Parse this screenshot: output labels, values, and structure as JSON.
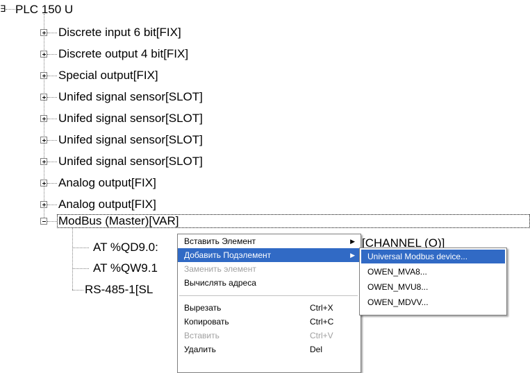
{
  "tree": {
    "root_label": "PLC 150 U",
    "root_expander": "∃",
    "children": [
      {
        "label": "Discrete input 6 bit[FIX]"
      },
      {
        "label": "Discrete output 4 bit[FIX]"
      },
      {
        "label": "Special output[FIX]"
      },
      {
        "label": "Unifed signal sensor[SLOT]"
      },
      {
        "label": "Unifed signal sensor[SLOT]"
      },
      {
        "label": "Unifed signal sensor[SLOT]"
      },
      {
        "label": "Unifed signal sensor[SLOT]"
      },
      {
        "label": "Analog output[FIX]"
      },
      {
        "label": "Analog output[FIX]"
      },
      {
        "label": "ModBus (Master)[VAR]"
      }
    ],
    "modbus_children": [
      {
        "label": "AT %QD9.0:"
      },
      {
        "label": "AT %QW9.1"
      },
      {
        "label": "RS-485-1[SL"
      }
    ],
    "partial_right_text": "[CHANNEL (O)]"
  },
  "context_menu": {
    "items": [
      {
        "label": "Вставить Элемент",
        "shortcut": "",
        "submenu": true,
        "state": "normal"
      },
      {
        "label": "Добавить Подэлемент",
        "shortcut": "",
        "submenu": true,
        "state": "highlighted"
      },
      {
        "label": "Заменить элемент",
        "shortcut": "",
        "submenu": false,
        "state": "disabled"
      },
      {
        "label": "Вычислять адреса",
        "shortcut": "",
        "submenu": false,
        "state": "normal"
      },
      {
        "label": "Вырезать",
        "shortcut": "Ctrl+X",
        "submenu": false,
        "state": "normal"
      },
      {
        "label": "Копировать",
        "shortcut": "Ctrl+C",
        "submenu": false,
        "state": "normal"
      },
      {
        "label": "Вставить",
        "shortcut": "Ctrl+V",
        "submenu": false,
        "state": "disabled"
      },
      {
        "label": "Удалить",
        "shortcut": "Del",
        "submenu": false,
        "state": "normal"
      }
    ]
  },
  "submenu": {
    "items": [
      {
        "label": "Universal Modbus device...",
        "state": "highlighted"
      },
      {
        "label": "OWEN_MVA8...",
        "state": "normal"
      },
      {
        "label": "OWEN_MVU8...",
        "state": "normal"
      },
      {
        "label": "OWEN_MDVV...",
        "state": "normal"
      }
    ]
  },
  "colors": {
    "highlight": "#316ac5",
    "disabled_text": "#a0a0a0",
    "tree_line": "#808080"
  }
}
